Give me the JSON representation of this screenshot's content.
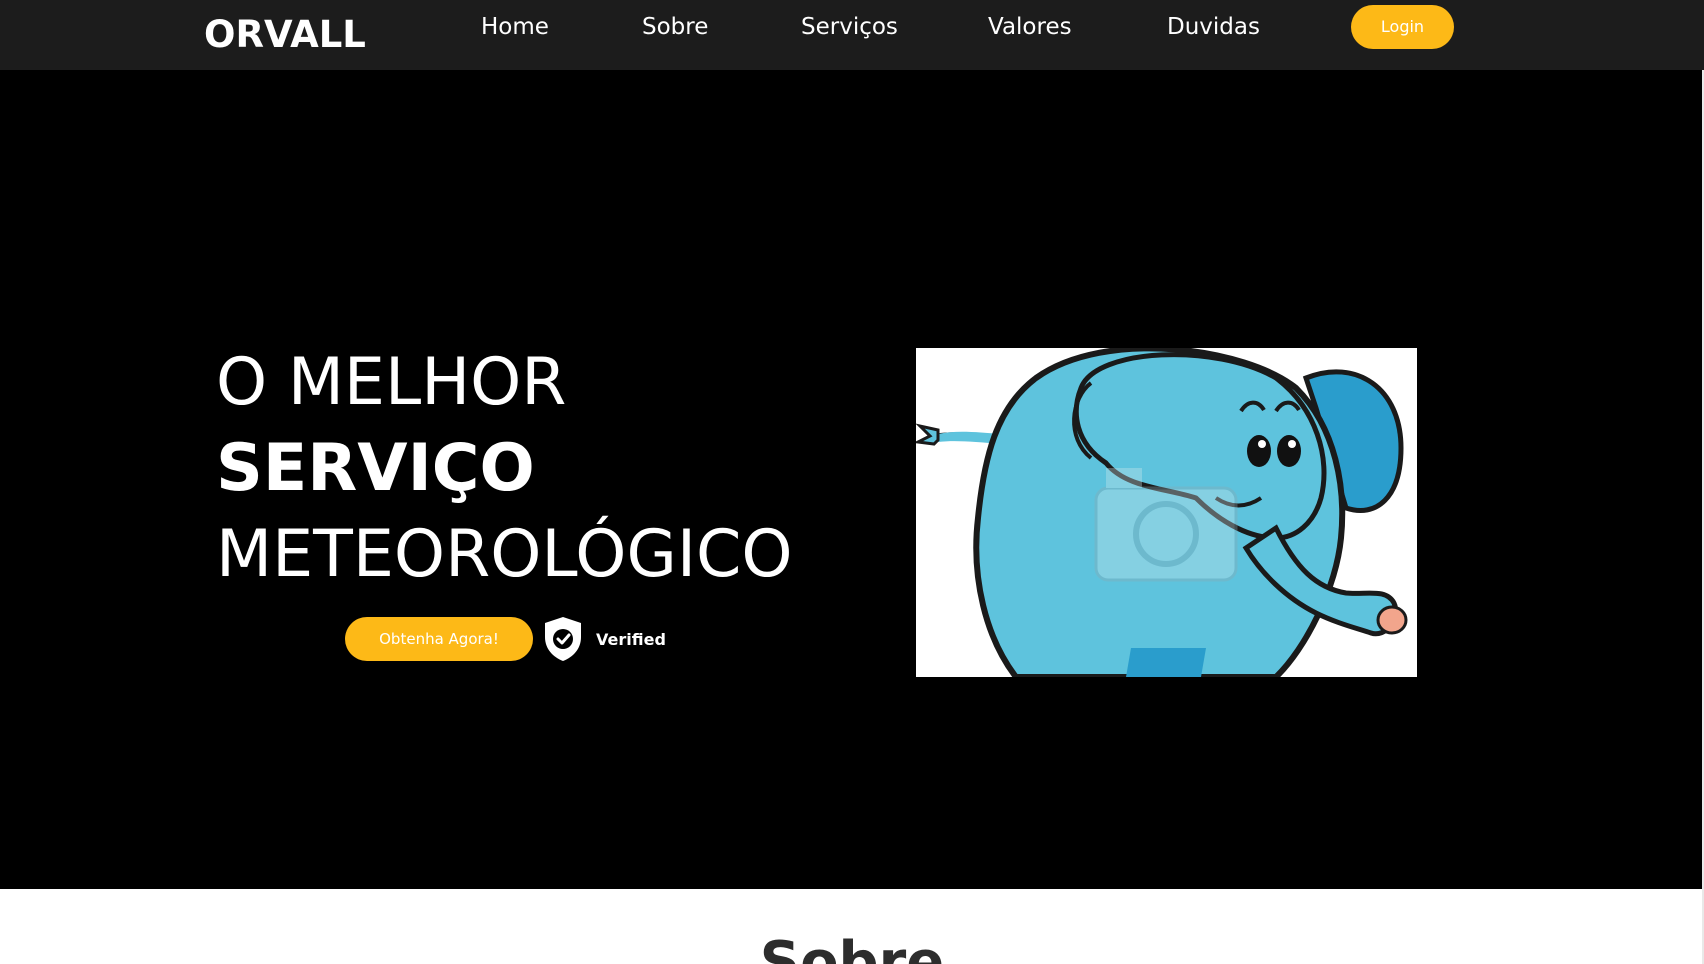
{
  "nav": {
    "logo": "ORVALL",
    "links": [
      {
        "label": "Home"
      },
      {
        "label": "Sobre"
      },
      {
        "label": "Serviços"
      },
      {
        "label": "Valores"
      },
      {
        "label": "Duvidas"
      }
    ],
    "login_label": "Login"
  },
  "hero": {
    "headline_line1": "O MELHOR",
    "headline_line2": "SERVIÇO",
    "headline_line3": "METEOROLÓGICO",
    "cta_label": "Obtenha Agora!",
    "verified_label": "Verified",
    "image_icon": "elephant-illustration"
  },
  "about": {
    "title": "Sobre"
  },
  "colors": {
    "navbar_bg": "#1c1c1c",
    "hero_bg": "#000000",
    "accent": "#fdb917",
    "text_light": "#ffffff",
    "elephant_blue": "#5ec3dd"
  }
}
